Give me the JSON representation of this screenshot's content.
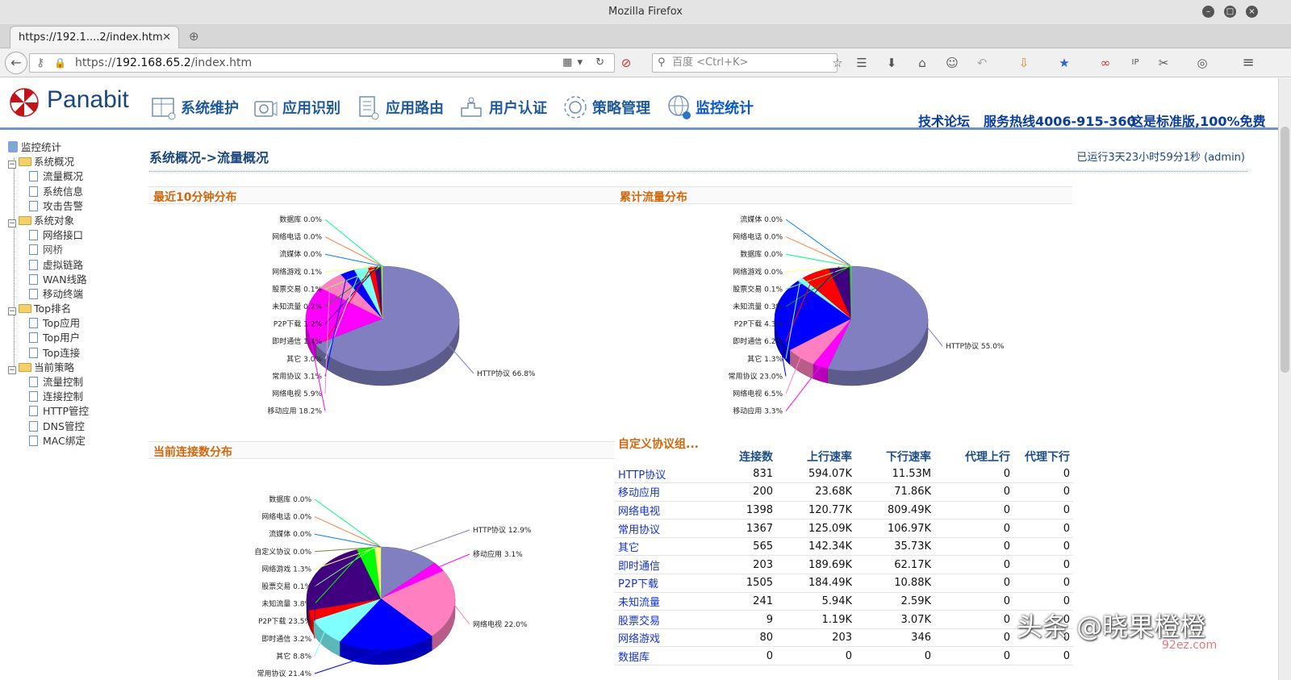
{
  "window": {
    "title": "Mozilla Firefox"
  },
  "tab": {
    "label": "https://192.1....2/index.htm"
  },
  "urlbar": {
    "protocol": "https://",
    "host": "192.168.65.2",
    "path": "/index.htm"
  },
  "searchbar": {
    "placeholder": "百度 <Ctrl+K>"
  },
  "app": {
    "brand": "Panabit",
    "nav": [
      "系统维护",
      "应用识别",
      "应用路由",
      "用户认证",
      "策略管理",
      "监控统计"
    ],
    "active_nav": "监控统计",
    "links": [
      "技术论坛",
      "服务热线4006-915-360",
      "这是标准版,100%免费"
    ]
  },
  "sidebar": {
    "root": "监控统计",
    "groups": [
      {
        "label": "系统概况",
        "items": [
          "流量概况",
          "系统信息",
          "攻击告警"
        ]
      },
      {
        "label": "系统对象",
        "items": [
          "网络接口",
          "网桥",
          "虚拟链路",
          "WAN线路",
          "移动终端"
        ]
      },
      {
        "label": "Top排名",
        "items": [
          "Top应用",
          "Top用户",
          "Top连接"
        ]
      },
      {
        "label": "当前策略",
        "items": [
          "流量控制",
          "连接控制",
          "HTTP管控",
          "DNS管控",
          "MAC绑定"
        ]
      }
    ]
  },
  "main": {
    "breadcrumb": "系统概况->流量概况",
    "uptime": "已运行3天23小时59分1秒 (admin)",
    "sections": {
      "recent": "最近10分钟分布",
      "cumulative": "累计流量分布",
      "connections": "当前连接数分布"
    }
  },
  "chart_data": [
    {
      "type": "pie",
      "title": "最近10分钟分布",
      "slices": [
        {
          "label": "HTTP协议",
          "value": 66.8,
          "color": "#8080c0"
        },
        {
          "label": "移动应用",
          "value": 18.2,
          "color": "#ff00ff"
        },
        {
          "label": "网络电视",
          "value": 5.9,
          "color": "#ff80c0"
        },
        {
          "label": "常用协议",
          "value": 3.1,
          "color": "#0000ff"
        },
        {
          "label": "其它",
          "value": 3.0,
          "color": "#80ffff"
        },
        {
          "label": "即时通信",
          "value": 1.4,
          "color": "#ff0000"
        },
        {
          "label": "P2P下载",
          "value": 1.2,
          "color": "#400080"
        },
        {
          "label": "未知流量",
          "value": 0.2,
          "color": "#00a000"
        },
        {
          "label": "股票交易",
          "value": 0.1,
          "color": "#80ff80"
        },
        {
          "label": "网络游戏",
          "value": 0.1,
          "color": "#ffff80"
        },
        {
          "label": "流媒体",
          "value": 0.0,
          "color": "#0080ff"
        },
        {
          "label": "网络电话",
          "value": 0.0,
          "color": "#ff8040"
        },
        {
          "label": "数据库",
          "value": 0.0,
          "color": "#00ff80"
        }
      ]
    },
    {
      "type": "pie",
      "title": "累计流量分布",
      "slices": [
        {
          "label": "HTTP协议",
          "value": 55.0,
          "color": "#8080c0"
        },
        {
          "label": "移动应用",
          "value": 3.3,
          "color": "#ff00ff"
        },
        {
          "label": "网络电视",
          "value": 6.5,
          "color": "#ff80c0"
        },
        {
          "label": "常用协议",
          "value": 23.0,
          "color": "#0000ff"
        },
        {
          "label": "其它",
          "value": 1.3,
          "color": "#80ffff"
        },
        {
          "label": "即时通信",
          "value": 6.2,
          "color": "#ff0000"
        },
        {
          "label": "P2P下载",
          "value": 4.3,
          "color": "#400080"
        },
        {
          "label": "未知流量",
          "value": 0.3,
          "color": "#00a000"
        },
        {
          "label": "股票交易",
          "value": 0.1,
          "color": "#80ff80"
        },
        {
          "label": "网络游戏",
          "value": 0.0,
          "color": "#ffff80"
        },
        {
          "label": "数据库",
          "value": 0.0,
          "color": "#00ff80"
        },
        {
          "label": "网络电话",
          "value": 0.0,
          "color": "#ff8040"
        },
        {
          "label": "流媒体",
          "value": 0.0,
          "color": "#0080ff"
        }
      ]
    },
    {
      "type": "pie",
      "title": "当前连接数分布",
      "slices": [
        {
          "label": "HTTP协议",
          "value": 12.9,
          "color": "#8080c0"
        },
        {
          "label": "移动应用",
          "value": 3.1,
          "color": "#ff00ff"
        },
        {
          "label": "网络电视",
          "value": 22.0,
          "color": "#ff80c0"
        },
        {
          "label": "常用协议",
          "value": 21.4,
          "color": "#0000ff"
        },
        {
          "label": "其它",
          "value": 8.8,
          "color": "#80ffff"
        },
        {
          "label": "即时通信",
          "value": 3.2,
          "color": "#ff0000"
        },
        {
          "label": "P2P下载",
          "value": 23.5,
          "color": "#400080"
        },
        {
          "label": "未知流量",
          "value": 3.8,
          "color": "#00ff00"
        },
        {
          "label": "股票交易",
          "value": 0.1,
          "color": "#80ff80"
        },
        {
          "label": "网络游戏",
          "value": 1.3,
          "color": "#ffff80"
        },
        {
          "label": "自定义协议",
          "value": 0.0,
          "color": "#808040"
        },
        {
          "label": "流媒体",
          "value": 0.0,
          "color": "#0080ff"
        },
        {
          "label": "网络电话",
          "value": 0.0,
          "color": "#ff8040"
        },
        {
          "label": "数据库",
          "value": 0.0,
          "color": "#00ff80"
        }
      ]
    }
  ],
  "table": {
    "headers": [
      "自定义协议组...",
      "连接数",
      "上行速率",
      "下行速率",
      "代理上行",
      "代理下行"
    ],
    "rows": [
      [
        "HTTP协议",
        "831",
        "594.07K",
        "11.53M",
        "0",
        "0"
      ],
      [
        "移动应用",
        "200",
        "23.68K",
        "71.86K",
        "0",
        "0"
      ],
      [
        "网络电视",
        "1398",
        "120.77K",
        "809.49K",
        "0",
        "0"
      ],
      [
        "常用协议",
        "1367",
        "125.09K",
        "106.97K",
        "0",
        "0"
      ],
      [
        "其它",
        "565",
        "142.34K",
        "35.73K",
        "0",
        "0"
      ],
      [
        "即时通信",
        "203",
        "189.69K",
        "62.17K",
        "0",
        "0"
      ],
      [
        "P2P下载",
        "1505",
        "184.49K",
        "10.88K",
        "0",
        "0"
      ],
      [
        "未知流量",
        "241",
        "5.94K",
        "2.59K",
        "0",
        "0"
      ],
      [
        "股票交易",
        "9",
        "1.19K",
        "3.07K",
        "0",
        "0"
      ],
      [
        "网络游戏",
        "80",
        "203",
        "346",
        "0",
        "0"
      ],
      [
        "数据库",
        "0",
        "0",
        "0",
        "0",
        "0"
      ]
    ]
  },
  "watermark": {
    "text": "头条 @晓果橙橙",
    "site": "92ez.com"
  }
}
